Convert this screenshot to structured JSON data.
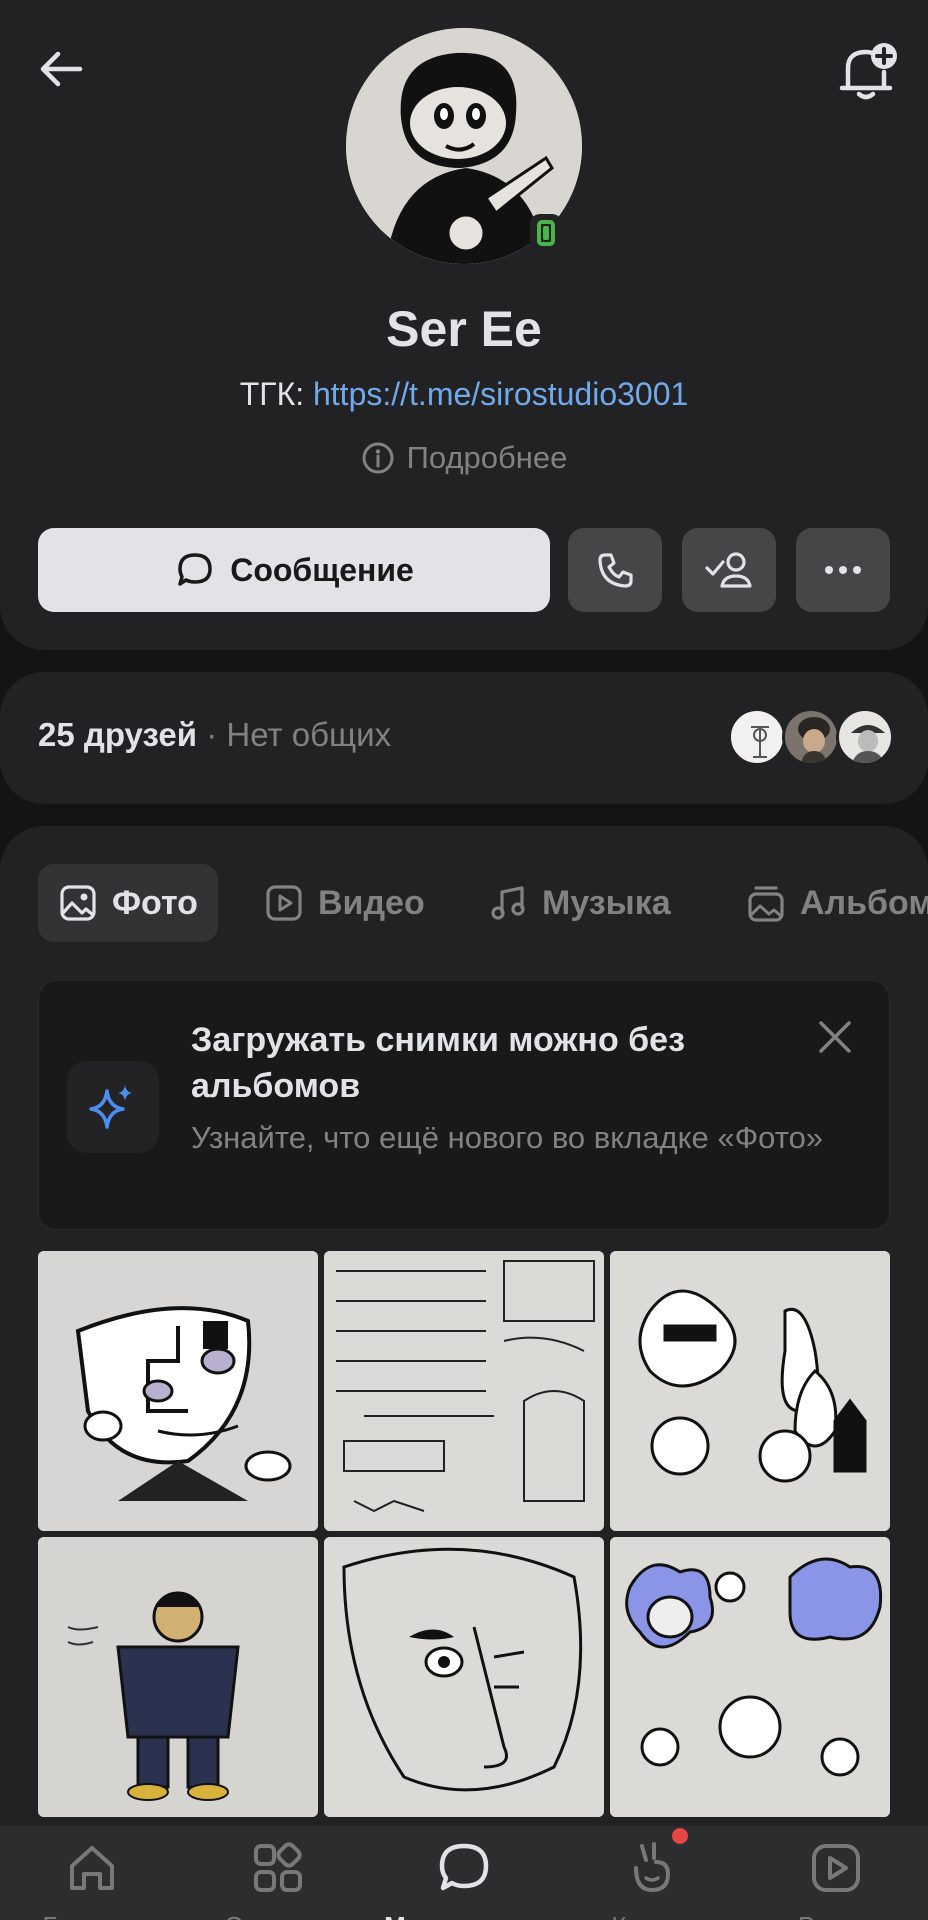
{
  "profile": {
    "name": "Ser Ee",
    "status_prefix": "ТГК: ",
    "status_link": "https://t.me/sirostudio3001",
    "more_info": "Подробнее"
  },
  "actions": {
    "message_label": "Сообщение",
    "call_icon": "phone-icon",
    "friend_icon": "friend-added-icon",
    "more_icon": "more-icon"
  },
  "friends": {
    "count_label": "25 друзей",
    "separator": " · ",
    "mutual_label": "Нет общих"
  },
  "tabs": [
    {
      "label": "Фото",
      "icon": "photo-icon",
      "active": true
    },
    {
      "label": "Видео",
      "icon": "video-icon"
    },
    {
      "label": "Музыка",
      "icon": "music-icon"
    },
    {
      "label": "Альбом",
      "icon": "album-icon"
    }
  ],
  "promo": {
    "title": "Загружать снимки можно без альбомов",
    "subtitle": "Узнайте, что ещё нового во вкладке «Фото»"
  },
  "nav": [
    {
      "label": "Главная",
      "icon": "home-icon"
    },
    {
      "label": "Сервисы",
      "icon": "services-icon"
    },
    {
      "label": "Мессенджер",
      "icon": "messenger-icon",
      "active": true
    },
    {
      "label": "Клипы",
      "icon": "clips-icon",
      "badge": true
    },
    {
      "label": "Видео",
      "icon": "video-nav-icon"
    }
  ],
  "colors": {
    "accent": "#71aaeb",
    "online": "#4bb34b",
    "badge": "#e64646",
    "background": "#141416",
    "card": "#222224"
  }
}
